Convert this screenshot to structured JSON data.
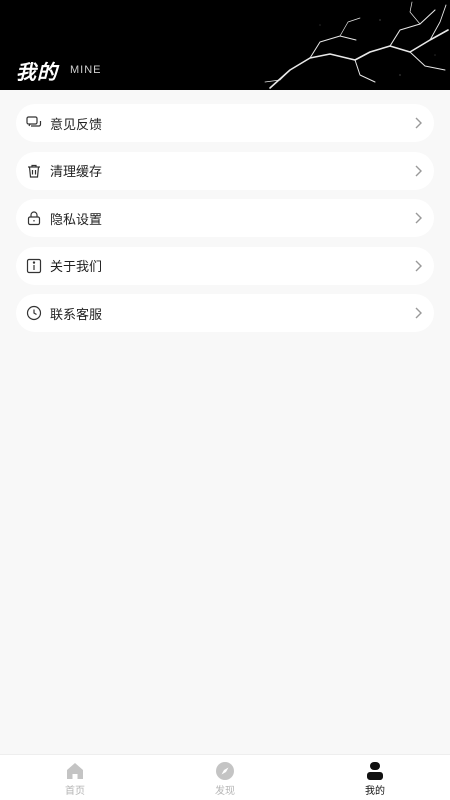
{
  "header": {
    "title": "我的",
    "subtitle": "MINE"
  },
  "menu": {
    "items": [
      {
        "label": "意见反馈",
        "icon": "chat-feedback-icon"
      },
      {
        "label": "清理缓存",
        "icon": "trash-icon"
      },
      {
        "label": "隐私设置",
        "icon": "lock-icon"
      },
      {
        "label": "关于我们",
        "icon": "info-icon"
      },
      {
        "label": "联系客服",
        "icon": "clock-service-icon"
      }
    ]
  },
  "tabbar": {
    "tabs": [
      {
        "label": "首页",
        "icon": "home-icon",
        "active": false
      },
      {
        "label": "发现",
        "icon": "compass-icon",
        "active": false
      },
      {
        "label": "我的",
        "icon": "user-icon",
        "active": true
      }
    ]
  },
  "colors": {
    "header_bg": "#000000",
    "page_bg": "#f8f8f8",
    "card_bg": "#ffffff",
    "text_primary": "#222222",
    "tab_inactive": "#b5b5b5",
    "tab_active": "#111111"
  }
}
